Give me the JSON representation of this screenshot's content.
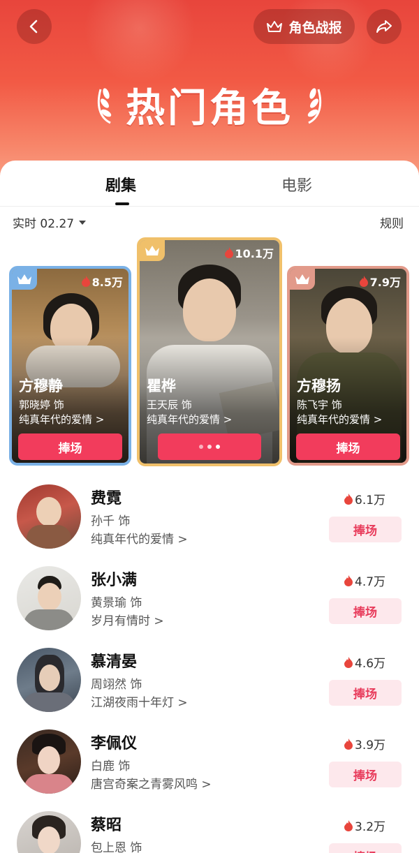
{
  "header": {
    "title": "热门角色",
    "report_label": "角色战报"
  },
  "tabs": [
    {
      "label": "剧集",
      "active": true
    },
    {
      "label": "电影",
      "active": false
    }
  ],
  "filter": {
    "realtime_label": "实时 02.27",
    "rules_label": "规则"
  },
  "podium": [
    {
      "rank": 2,
      "name": "方穆静",
      "actor": "郭晓婷 饰",
      "drama": "纯真年代的爱情 >",
      "heat": "8.5万",
      "button": "捧场",
      "crown_color": "#7ab1e6"
    },
    {
      "rank": 1,
      "name": "瞿桦",
      "actor": "王天辰 饰",
      "drama": "纯真年代的爱情 >",
      "heat": "10.1万",
      "button": "",
      "crown_color": "#f0c06a"
    },
    {
      "rank": 3,
      "name": "方穆扬",
      "actor": "陈飞宇 饰",
      "drama": "纯真年代的爱情 >",
      "heat": "7.9万",
      "button": "捧场",
      "crown_color": "#e29a8a"
    }
  ],
  "list": [
    {
      "name": "费霓",
      "actor": "孙千 饰",
      "drama": "纯真年代的爱情 >",
      "heat": "6.1万",
      "button": "捧场"
    },
    {
      "name": "张小满",
      "actor": "黄景瑜 饰",
      "drama": "岁月有情时 >",
      "heat": "4.7万",
      "button": "捧场"
    },
    {
      "name": "慕清晏",
      "actor": "周翊然 饰",
      "drama": "江湖夜雨十年灯 >",
      "heat": "4.6万",
      "button": "捧场"
    },
    {
      "name": "李佩仪",
      "actor": "白鹿 饰",
      "drama": "唐宫奇案之青雾风鸣 >",
      "heat": "3.9万",
      "button": "捧场"
    },
    {
      "name": "蔡昭",
      "actor": "包上恩 饰",
      "drama": "",
      "heat": "3.2万",
      "button": "捧场"
    }
  ],
  "colors": {
    "accent": "#f23c5c",
    "light_button_bg": "#fde8ec",
    "flame": "#e8453c"
  }
}
